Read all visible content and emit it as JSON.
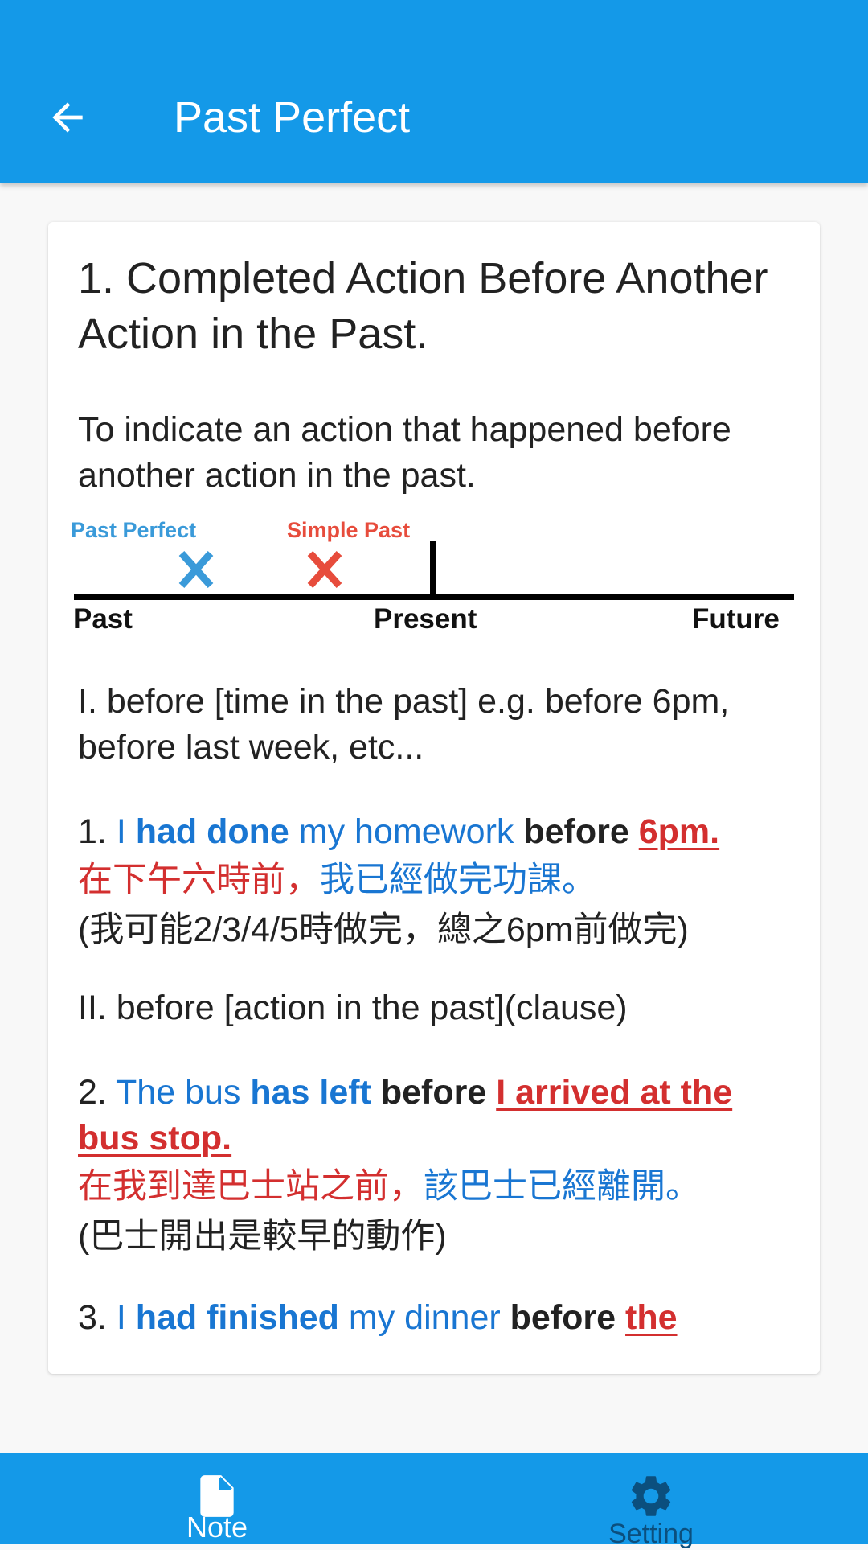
{
  "appbar": {
    "title": "Past Perfect",
    "back_icon": "arrow-left-icon",
    "color": "#1499e8"
  },
  "content": {
    "heading": "1. Completed Action Before Another Action in the Past.",
    "description": "To indicate an action that happened before another action in the past.",
    "timeline": {
      "past_perfect_label": "Past Perfect",
      "simple_past_label": "Simple Past",
      "past_label": "Past",
      "present_label": "Present",
      "future_label": "Future",
      "past_perfect_color": "#3a9ad9",
      "simple_past_color": "#e74c3c"
    },
    "section_1": "I. before [time in the past] e.g. before 6pm, before last week, etc...",
    "example_1": {
      "num": "1. ",
      "subject": "I ",
      "verb": "had done",
      "object": " my homework ",
      "before": "before ",
      "time": "6pm.",
      "zh_red": "在下午六時前，",
      "zh_blue": "我已經做完功課。",
      "note": "(我可能2/3/4/5時做完，總之6pm前做完)"
    },
    "section_2": "II. before [action in the past](clause)",
    "example_2": {
      "num": "2. ",
      "subject": "The bus ",
      "verb": "has left",
      "before": " before ",
      "clause": "I arrived at the bus stop.",
      "zh_red": "在我到達巴士站之前，",
      "zh_blue": "該巴士已經離開。",
      "note": "(巴士開出是較早的動作)"
    },
    "example_3": {
      "num": "3. ",
      "subject": "I ",
      "verb": "had finished",
      "object": " my dinner ",
      "before": "before ",
      "clause": "the "
    }
  },
  "bottom_nav": {
    "items": [
      {
        "label": "Note",
        "icon": "note-icon",
        "active": true
      },
      {
        "label": "Setting",
        "icon": "gear-icon",
        "active": false
      }
    ],
    "active_color": "#ffffff",
    "inactive_color": "#0b4f7e"
  }
}
